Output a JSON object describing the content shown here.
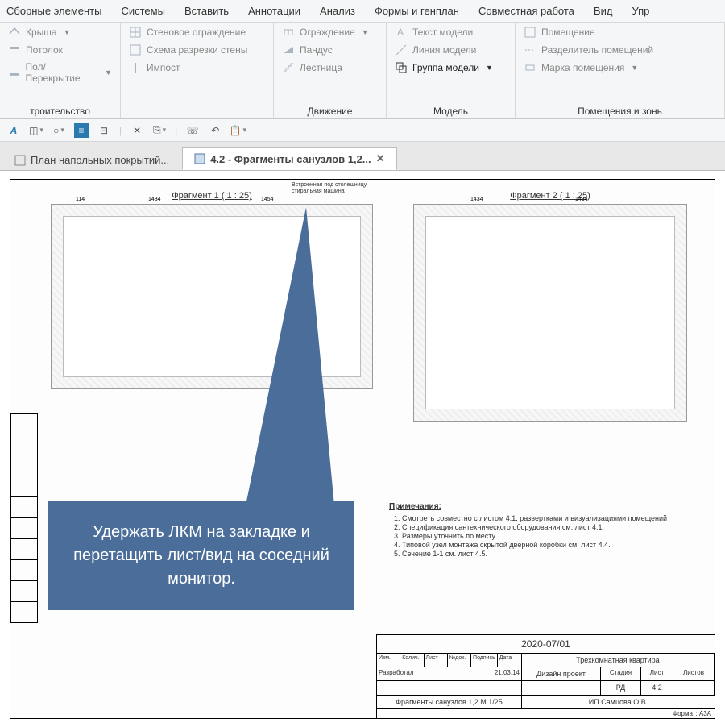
{
  "menu": [
    "Сборные элементы",
    "Системы",
    "Вставить",
    "Аннотации",
    "Анализ",
    "Формы и генплан",
    "Совместная работа",
    "Вид",
    "Упр"
  ],
  "ribbon": {
    "g1": {
      "items": [
        {
          "label": "Крыша",
          "dd": true
        },
        {
          "label": "Потолок"
        },
        {
          "label": "Пол/Перекрытие",
          "dd": true
        }
      ],
      "title": "троительство"
    },
    "g2": {
      "items": [
        {
          "label": "Стеновое ограждение"
        },
        {
          "label": "Схема разрезки стены"
        },
        {
          "label": "Импост"
        }
      ],
      "title": ""
    },
    "g3": {
      "items": [
        {
          "label": "Ограждение",
          "dd": true
        },
        {
          "label": "Пандус"
        },
        {
          "label": "Лестница"
        }
      ],
      "title": "Движение"
    },
    "g4": {
      "items": [
        {
          "label": "Текст модели"
        },
        {
          "label": "Линия  модели"
        },
        {
          "label": "Группа модели",
          "dd": true,
          "active": true
        }
      ],
      "title": "Модель"
    },
    "g5": {
      "items": [
        {
          "label": "Помещение"
        },
        {
          "label": "Разделитель помещений"
        },
        {
          "label": "Марка помещения",
          "dd": true
        }
      ],
      "title": "Помещения и зонь"
    }
  },
  "tabs": {
    "t1": "План напольных покрытий...",
    "t2": "4.2 - Фрагменты санузлов 1,2..."
  },
  "drawing": {
    "frag1": "Фрагмент 1 ( 1 : 25)",
    "frag2": "Фрагмент 2 ( 1 : 25)",
    "wm_label": "Встроенная под столешницу стиральная машина"
  },
  "callout": "Удержать ЛКМ на закладке и перетащить лист/вид на соседний монитор.",
  "notes": {
    "title": "Примечания:",
    "items": [
      "Смотреть совместно с листом 4.1, развертками и визуализациями помещений",
      "Спецификация сантехнического оборудования см. лист 4.1.",
      "Размеры уточнить по месту.",
      "Типовой узел монтажа скрытой дверной коробки см. лист 4.4.",
      "Сечение 1-1 см. лист 4.5."
    ]
  },
  "titleblock": {
    "code": "2020-07/01",
    "project": "Трехкомнатная квартира",
    "doc": "Дизайн проект",
    "sheet": "Фрагменты санузлов 1,2 М 1/25",
    "author": "ИП Самцова О.В.",
    "stage": "РД",
    "sheet_no": "4.2",
    "cols": [
      "Изм.",
      "Колич.",
      "Лист",
      "№док.",
      "Подпись",
      "Дата"
    ],
    "date": "21.03.14",
    "dev": "Разработал",
    "stage_h": "Стадия",
    "sheet_h": "Лист",
    "sheets_h": "Листов",
    "format": "Формат: А3А"
  }
}
